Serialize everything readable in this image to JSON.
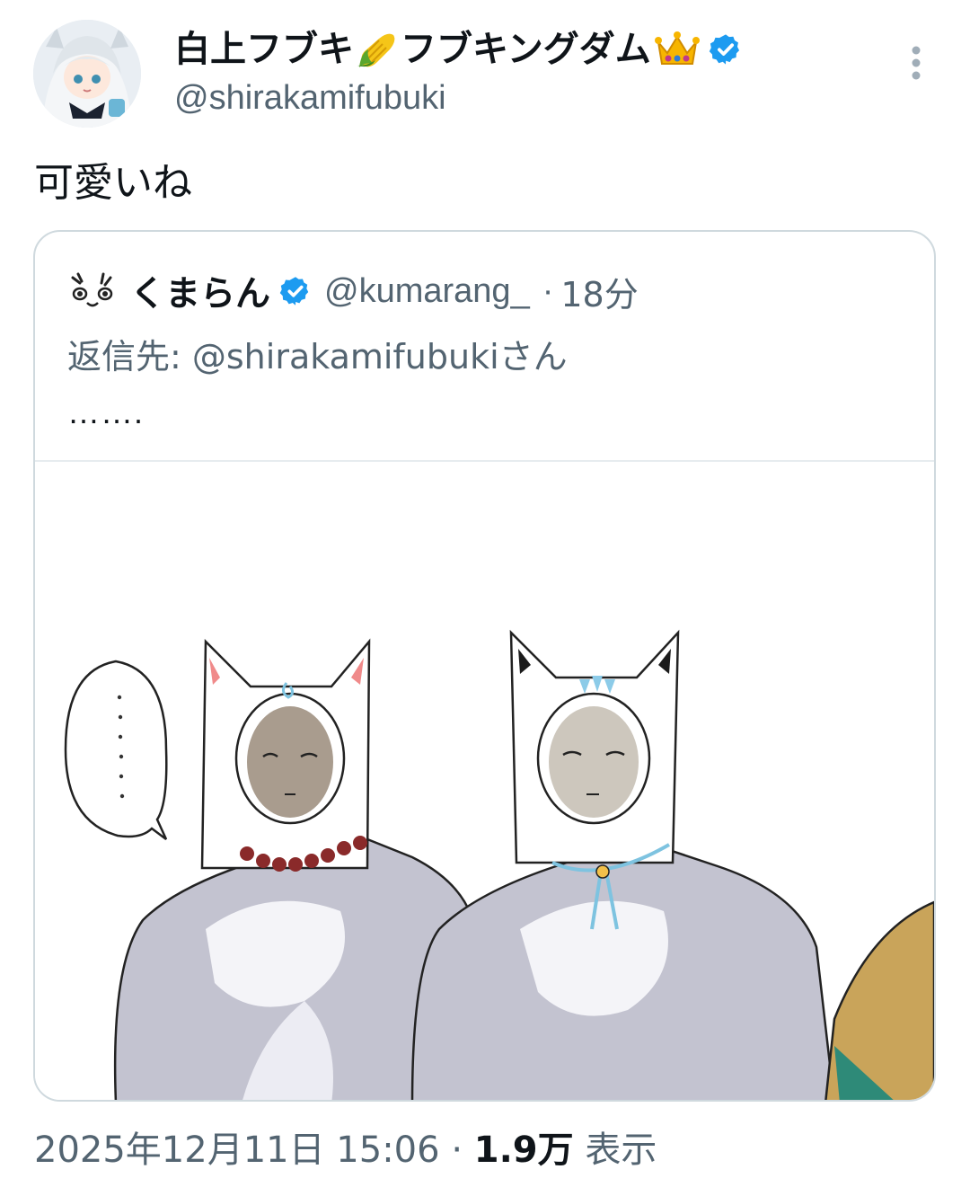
{
  "tweet": {
    "display_name_part1": "白上フブキ",
    "display_name_part2": "フブキングダム",
    "handle": "@shirakamifubuki",
    "text": "可愛いね",
    "timestamp": "2025年12月11日 15:06",
    "separator": "·",
    "views_count": "1.9万",
    "views_label": "表示"
  },
  "quote": {
    "name": "くまらん",
    "handle": "@kumarang_",
    "separator": "·",
    "time": "18分",
    "reply_to": "返信先: @shirakamifubukiさん",
    "text": "……."
  },
  "colors": {
    "verified": "#1d9bf0",
    "secondary_text": "#536471",
    "border": "#cfd9de"
  }
}
